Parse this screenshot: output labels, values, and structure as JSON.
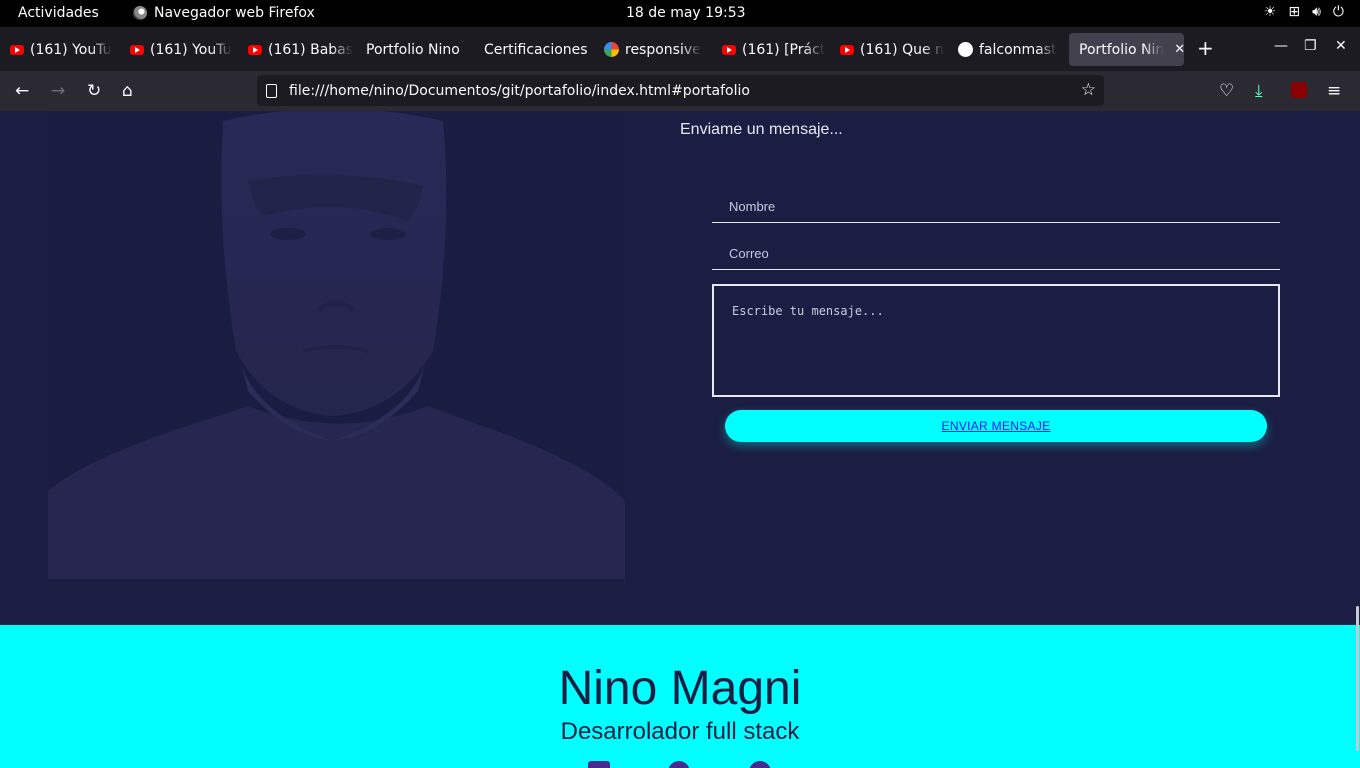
{
  "system": {
    "activities": "Actividades",
    "app_name": "Navegador web Firefox",
    "clock": "18 de may  19:53"
  },
  "tabs": [
    {
      "label": "(161) YouTu",
      "icon": "youtube-icon"
    },
    {
      "label": "(161) YouTu",
      "icon": "youtube-icon"
    },
    {
      "label": "(161) Babas",
      "icon": "youtube-icon"
    },
    {
      "label": "Portfolio Nino",
      "icon": ""
    },
    {
      "label": "Certificaciones",
      "icon": ""
    },
    {
      "label": "responsive",
      "icon": "google-icon"
    },
    {
      "label": "(161) [Práct",
      "icon": "youtube-icon"
    },
    {
      "label": "(161) Que n",
      "icon": "youtube-icon"
    },
    {
      "label": "falconmast",
      "icon": "github-icon"
    },
    {
      "label": "Portfolio Nin",
      "icon": "",
      "active": true
    }
  ],
  "navbar": {
    "url": "file:///home/nino/Documentos/git/portafolio/index.html#portafolio"
  },
  "contact": {
    "title": "Enviame un mensaje...",
    "name_placeholder": "Nombre",
    "email_placeholder": "Correo",
    "message_placeholder": "Escribe tu mensaje...",
    "send_label": "ENVIAR MENSAJE"
  },
  "footer": {
    "name": "Nino Magni",
    "role": "Desarrolador full stack"
  },
  "colors": {
    "background": "#1b1d42",
    "accent": "#00ffff",
    "social_icons": "#4a2c8f"
  }
}
